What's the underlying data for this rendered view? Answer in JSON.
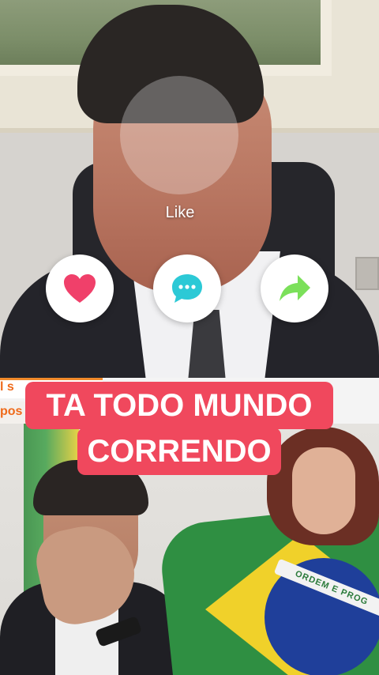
{
  "overlay": {
    "like_label": "Like"
  },
  "actions": {
    "like_icon": "heart-icon",
    "comment_icon": "chat-bubble-icon",
    "share_icon": "share-arrow-icon",
    "colors": {
      "heart": "#f0406a",
      "comment": "#2cc9d6",
      "share": "#7be05a"
    }
  },
  "ticker": {
    "line1": "l s",
    "line2": "pos"
  },
  "caption": {
    "line1": "TA TODO MUNDO",
    "line2": "CORRENDO",
    "background": "#f0485d"
  },
  "photo": {
    "flag_band_text": "ORDEM E PROG"
  }
}
